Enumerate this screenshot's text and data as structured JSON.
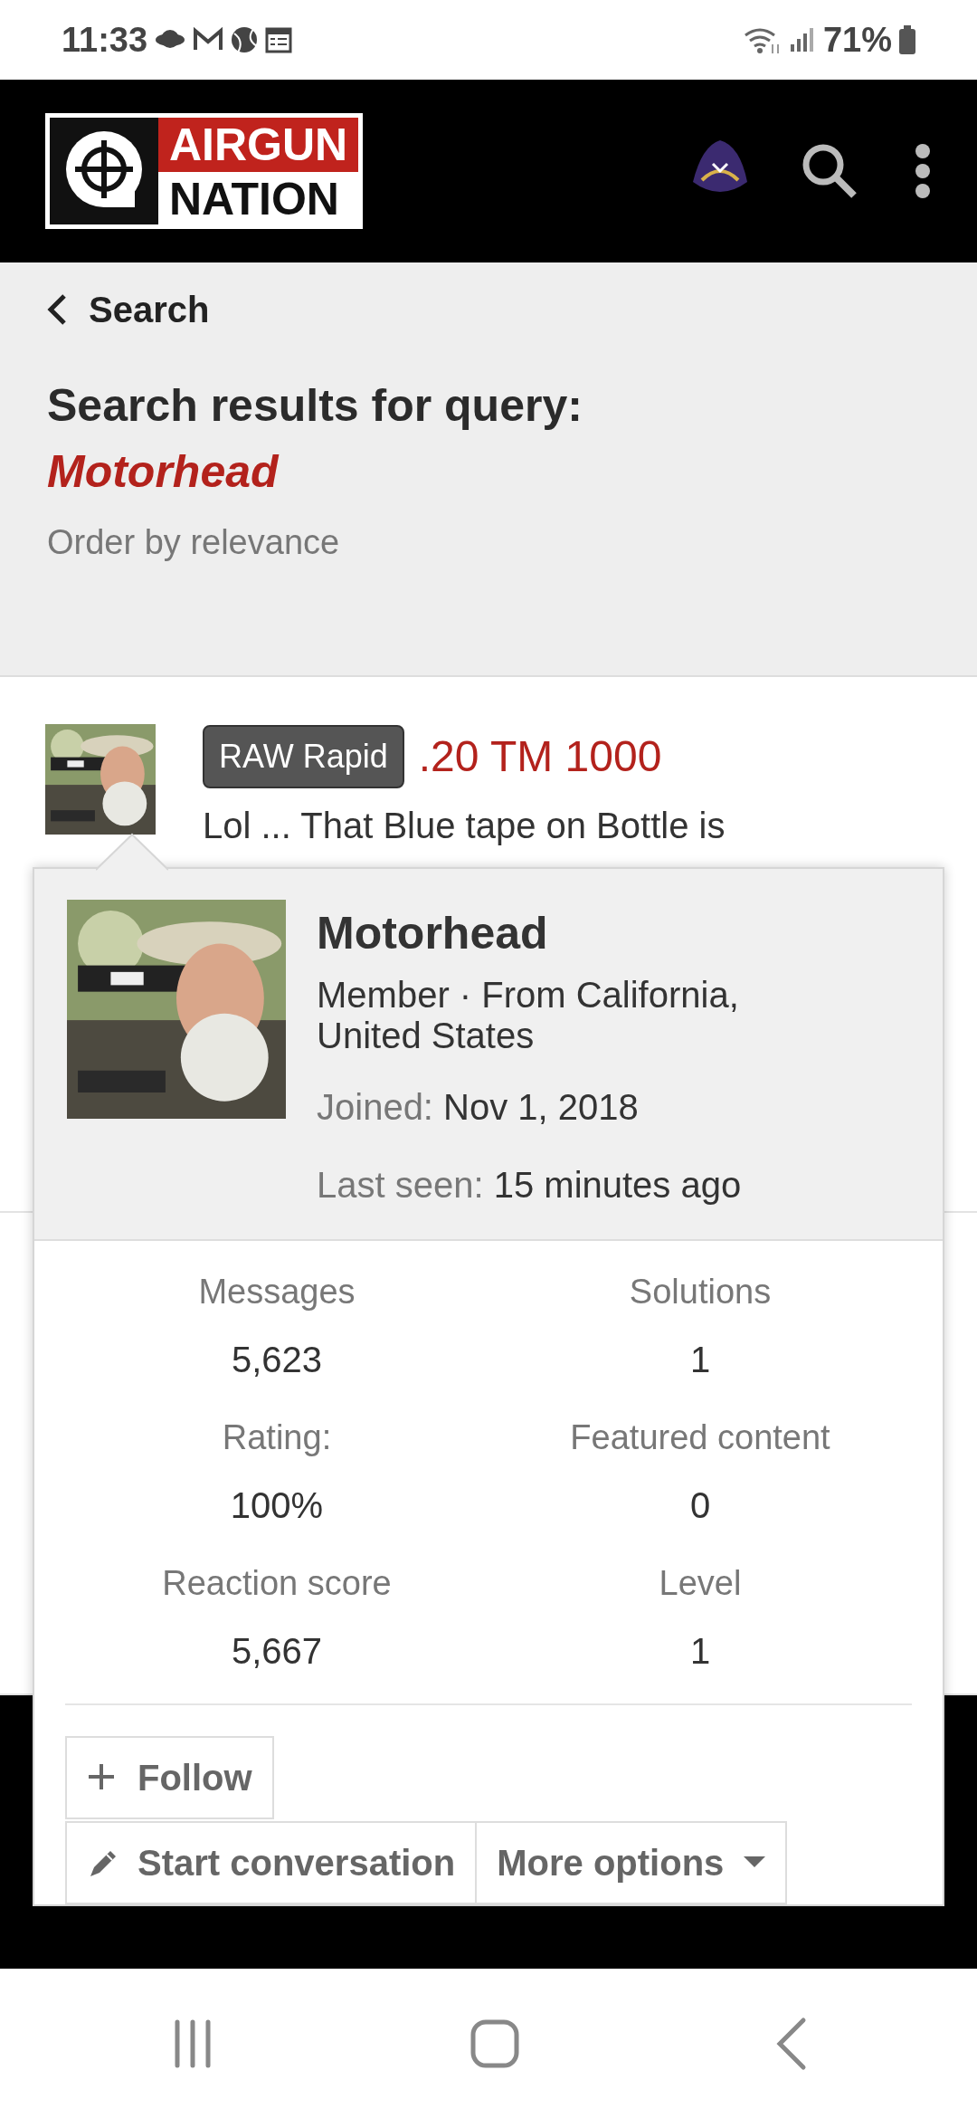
{
  "status_bar": {
    "time": "11:33",
    "battery": "71%"
  },
  "header": {
    "logo": {
      "line_1": "AIRGUN",
      "line_2": "NATION"
    }
  },
  "breadcrumb": {
    "label": "Search"
  },
  "page_title": {
    "text": "Search results for query:",
    "query": "Motorhead"
  },
  "order": "Order by relevance",
  "results": [
    {
      "prefix": "RAW Rapid",
      "title": ".20 TM 1000",
      "snippet": "Lol ... That Blue tape on Bottle is"
    }
  ],
  "member_card": {
    "name": "Motorhead",
    "info": "Member · From California, United States",
    "fields": [
      {
        "label": "Joined:",
        "value": "Nov 1, 2018"
      },
      {
        "label": "Last seen:",
        "value": "15 minutes ago"
      }
    ],
    "stats": [
      {
        "label": "Messages",
        "value": "5,623"
      },
      {
        "label": "Solutions",
        "value": "1"
      },
      {
        "label": "Rating:",
        "value": "100%"
      },
      {
        "label": "Featured content",
        "value": "0"
      },
      {
        "label": "Reaction score",
        "value": "5,667"
      },
      {
        "label": "Level",
        "value": "1"
      }
    ],
    "buttons": [
      {
        "label": "Follow",
        "kind": "follow"
      },
      {
        "label": "Start conversation",
        "kind": "conversation"
      },
      {
        "label": "More options",
        "kind": "menu"
      }
    ]
  }
}
